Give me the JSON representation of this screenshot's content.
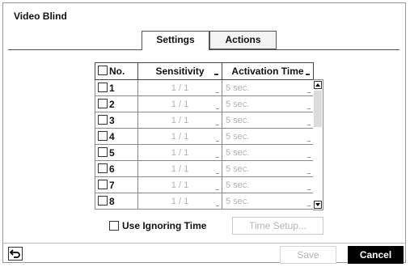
{
  "window": {
    "title": "Video Blind"
  },
  "tabs": [
    {
      "label": "Settings",
      "active": true
    },
    {
      "label": "Actions",
      "active": false
    }
  ],
  "table": {
    "headers": {
      "no": "No.",
      "sensitivity": "Sensitivity",
      "activation_time": "Activation Time"
    },
    "rows": [
      {
        "no": "1",
        "sensitivity": "1 / 1",
        "activation_time": "5 sec."
      },
      {
        "no": "2",
        "sensitivity": "1 / 1",
        "activation_time": "5 sec."
      },
      {
        "no": "3",
        "sensitivity": "1 / 1",
        "activation_time": "5 sec."
      },
      {
        "no": "4",
        "sensitivity": "1 / 1",
        "activation_time": "5 sec."
      },
      {
        "no": "5",
        "sensitivity": "1 / 1",
        "activation_time": "5 sec."
      },
      {
        "no": "6",
        "sensitivity": "1 / 1",
        "activation_time": "5 sec."
      },
      {
        "no": "7",
        "sensitivity": "1 / 1",
        "activation_time": "5 sec."
      },
      {
        "no": "8",
        "sensitivity": "1 / 1",
        "activation_time": "5 sec."
      }
    ]
  },
  "options": {
    "use_ignoring_time_label": "Use Ignoring Time",
    "time_setup_label": "Time Setup..."
  },
  "footer": {
    "save_label": "Save",
    "cancel_label": "Cancel"
  },
  "colors": {
    "accent": "#000000",
    "disabled_text": "#b5b5b5"
  }
}
